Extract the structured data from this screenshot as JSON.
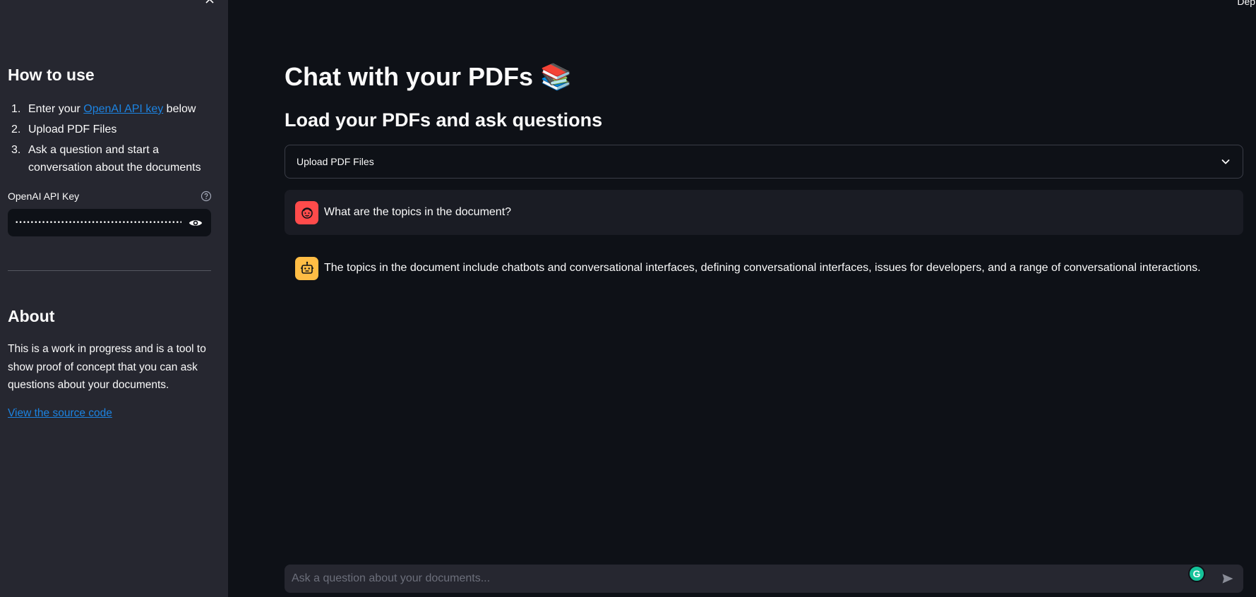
{
  "header": {
    "deploy_label": "Deplo"
  },
  "sidebar": {
    "howto_title": "How to use",
    "steps": [
      {
        "num": "1.",
        "prefix": "Enter your ",
        "link": "OpenAI API key",
        "suffix": " below"
      },
      {
        "num": "2.",
        "text": "Upload PDF Files"
      },
      {
        "num": "3.",
        "text": "Ask a question and start a conversation about the documents"
      }
    ],
    "api_key_label": "OpenAI API Key",
    "api_key_value": "••••••••••••••••••••••••••••••••••••••••••••••••••••",
    "about_title": "About",
    "about_text": "This is a work in progress and is a tool to show proof of concept that you can ask questions about your documents.",
    "source_link": "View the source code"
  },
  "main": {
    "title": "Chat with your PDFs 📚",
    "subtitle": "Load your PDFs and ask questions",
    "expander_label": "Upload PDF Files",
    "messages": [
      {
        "role": "user",
        "text": "What are the topics in the document?"
      },
      {
        "role": "assistant",
        "text": "The topics in the document include chatbots and conversational interfaces, defining conversational interfaces, issues for developers, and a range of conversational interactions."
      }
    ],
    "chat_placeholder": "Ask a question about your documents..."
  },
  "colors": {
    "background": "#0e1117",
    "sidebar": "#262730",
    "link": "#1c83e1",
    "user_avatar": "#ff4b4b",
    "bot_avatar": "#ffbd45"
  },
  "icons": [
    "close-icon",
    "help-icon",
    "eye-icon",
    "chevron-down-icon",
    "user-avatar-icon",
    "bot-avatar-icon",
    "send-icon",
    "grammarly-icon"
  ]
}
